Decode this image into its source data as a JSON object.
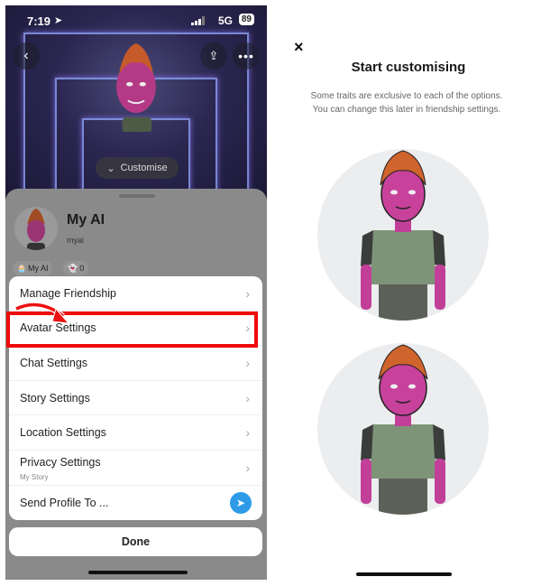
{
  "status_bar": {
    "time": "7:19",
    "network": "5G",
    "battery": "89"
  },
  "left": {
    "hero": {
      "customise_label": "Customise"
    },
    "profile": {
      "name": "My AI",
      "username": "myai",
      "chips": [
        {
          "icon": "bitmoji-icon",
          "label": "My AI"
        },
        {
          "icon": "ghost-icon",
          "label": "0"
        }
      ]
    },
    "menu": [
      {
        "label": "Manage Friendship"
      },
      {
        "label": "Avatar Settings",
        "highlighted": true
      },
      {
        "label": "Chat Settings"
      },
      {
        "label": "Story Settings"
      },
      {
        "label": "Location Settings"
      },
      {
        "label": "Privacy Settings",
        "sub": "My Story"
      },
      {
        "label": "Send Profile To ..."
      }
    ],
    "done_label": "Done",
    "highlight_color": "#ef0b0b"
  },
  "right": {
    "close_icon": "×",
    "title": "Start customising",
    "description": "Some traits are exclusive to each of the options. You can change this later in friendship settings.",
    "options": [
      {
        "name": "avatar-option-1"
      },
      {
        "name": "avatar-option-2"
      }
    ]
  }
}
